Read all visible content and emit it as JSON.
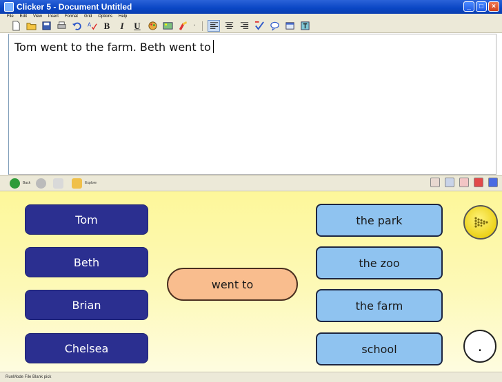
{
  "window": {
    "title": "Clicker 5 - Document Untitled",
    "controls": [
      "minimize",
      "maximize",
      "close"
    ]
  },
  "menu": [
    "File",
    "Edit",
    "View",
    "Insert",
    "Format",
    "Grid",
    "Options",
    "Help"
  ],
  "toolbar": {
    "bold_label": "B",
    "italic_label": "I",
    "underline_label": "U",
    "dropdown_glyph": "·"
  },
  "document": {
    "text": "Tom went to the farm. Beth went to"
  },
  "navbar": {
    "back_label": "Back",
    "explore_label": "Explore"
  },
  "grid": {
    "names": [
      "Tom",
      "Beth",
      "Brian",
      "Chelsea"
    ],
    "verb": "went to",
    "places": [
      "the park",
      "the zoo",
      "the farm",
      "school"
    ],
    "period": ".",
    "colors": {
      "background": "#fdf79a",
      "name_cell": "#2b2f90",
      "place_cell": "#8fc3f0",
      "verb_cell": "#f9bd8e",
      "speak_button": "#ecd21a"
    }
  },
  "status": {
    "text": "RunMode  File Blank pick"
  }
}
